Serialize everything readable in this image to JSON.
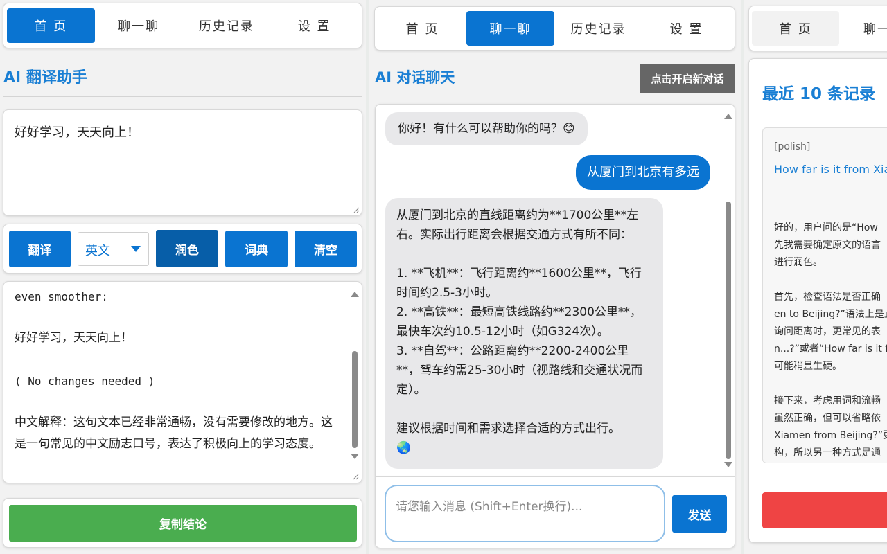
{
  "panel1": {
    "tabs": [
      "首 页",
      "聊一聊",
      "历史记录",
      "设 置"
    ],
    "title": "AI 翻译助手",
    "input_text": "好好学习，天天向上！",
    "buttons": {
      "translate": "翻译",
      "polish": "润色",
      "dictionary": "词典",
      "clear": "清空",
      "copy": "复制结论"
    },
    "language": "英文",
    "output": {
      "line1": "even smoother:",
      "line2": "好好学习，天天向上！",
      "line3": "( No changes needed )",
      "line4": "中文解释：这句文本已经非常通畅，没有需要修改的地方。这是一句常见的中文励志口号，表达了积极向上的学习态度。"
    }
  },
  "panel2": {
    "tabs": [
      "首 页",
      "聊一聊",
      "历史记录",
      "设 置"
    ],
    "title": "AI 对话聊天",
    "new_chat": "点击开启新对话",
    "messages": {
      "greeting": "你好！有什么可以帮助你的吗？😊",
      "user": "从厦门到北京有多远",
      "reply": "从厦门到北京的直线距离约为**1700公里**左右。实际出行距离会根据交通方式有所不同：\n\n1. **飞机**：飞行距离约**1600公里**，飞行时间约2.5-3小时。\n2. **高铁**：最短高铁线路约**2300公里**，最快车次约10.5-12小时（如G324次）。\n3. **自驾**：公路距离约**2200-2400公里**，驾车约需25-30小时（视路线和交通状况而定）。\n\n建议根据时间和需求选择合适的方式出行。\n🌏"
    },
    "input_placeholder": "请您输入消息 (Shift+Enter换行)...",
    "send": "发送"
  },
  "panel3": {
    "tabs": [
      "首 页",
      "聊一"
    ],
    "title": "最近 10 条记录",
    "record": {
      "tag": "[polish]",
      "link": "How far is it from Xiar",
      "body": "好的，用户问的是“How\n先我需要确定原文的语言\n进行润色。\n\n首先，检查语法是否正确\nen to Beijing?”语法上是正\n询问距离时，更常见的表\nn...?”或者“How far is it fr\n可能稍显生硬。\n\n接下来，考虑用词和流畅\n虽然正确，但可以省略依\nXiamen from Beijing?”更\n构，所以另一种方式是通"
    }
  },
  "colors": {
    "accent": "#0a74d1",
    "title": "#1a7fd4",
    "copy_button": "#4aad4f",
    "delete_button": "#ef4444"
  }
}
